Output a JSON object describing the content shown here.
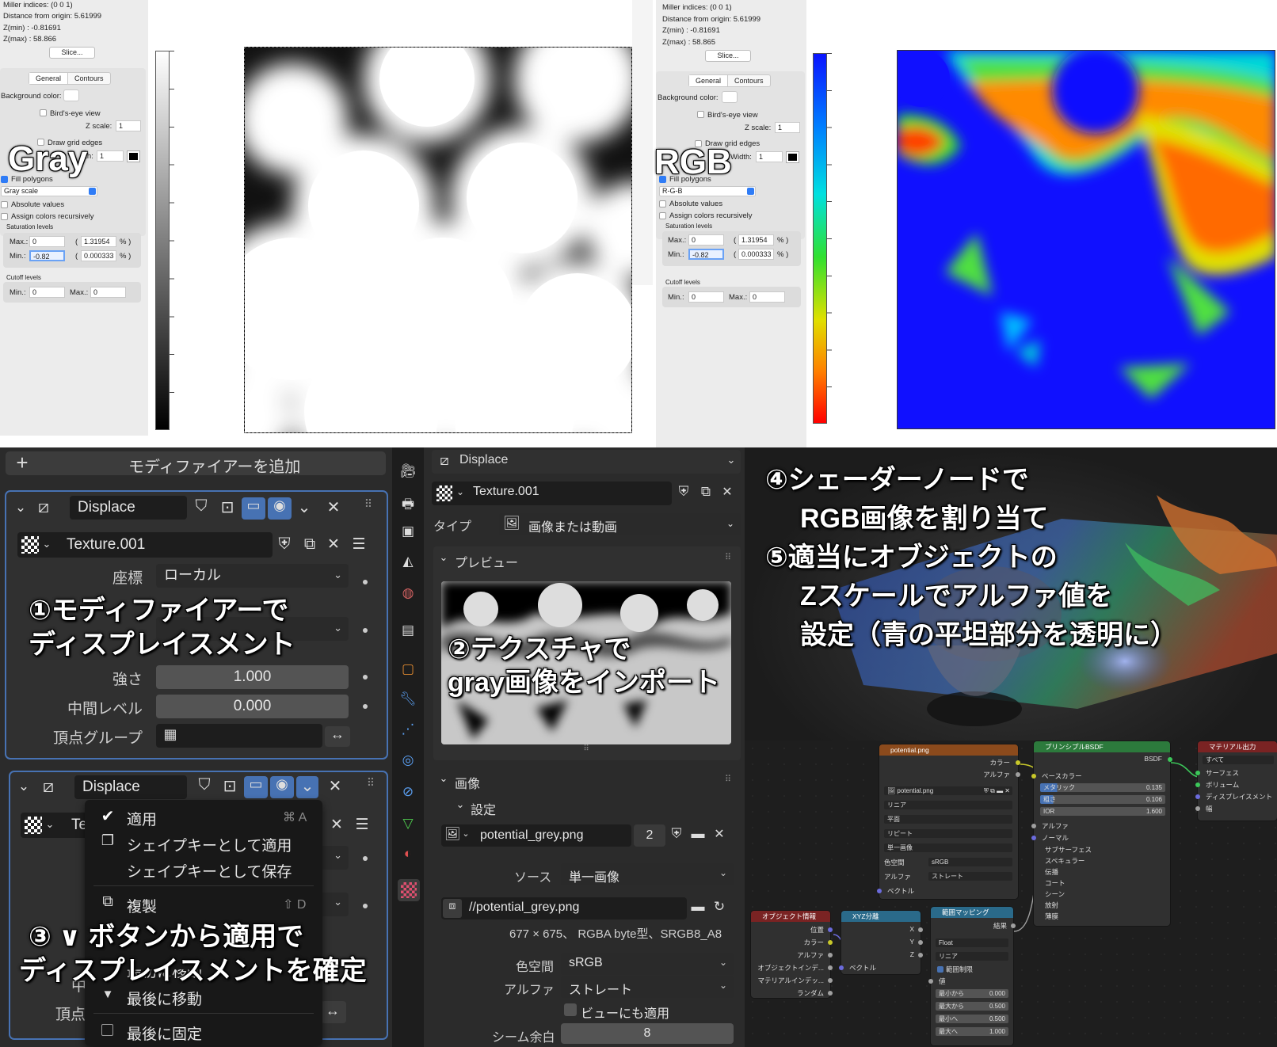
{
  "top_left": {
    "info": [
      "Miller indices: (0 0 1)",
      "Distance from origin: 5.61999",
      "Z(min) : -0.81691",
      "Z(max) : 58.866"
    ],
    "slice_button": "Slice...",
    "tabs": [
      "General",
      "Contours"
    ],
    "background_color": "Background color:",
    "birds_eye": "Bird's-eye view",
    "z_scale_label": "Z scale:",
    "z_scale": "1",
    "draw_grid": "Draw grid edges",
    "width_label": "dth:",
    "width_value": "1",
    "fill_polygons": "Fill polygons",
    "scale_select": "Gray scale",
    "absolute_values": "Absolute values",
    "assign_colors": "Assign colors recursively",
    "saturation": "Saturation levels",
    "max_label": "Max.:",
    "max_value": "0",
    "max_pct": "1.31954",
    "min_label": "Min.:",
    "min_value": "-0.82",
    "min_pct": "0.000333",
    "pct": "% )",
    "paren": "(",
    "cutoff": "Cutoff levels",
    "cut_min_label": "Min.:",
    "cut_min": "0",
    "cut_max_label": "Max.:",
    "cut_max": "0",
    "big_label": "Gray"
  },
  "top_right": {
    "info": [
      "Miller indices: (0 0 1)",
      "Distance from origin: 5.61999",
      "Z(min) : -0.81691",
      "Z(max) : 58.865"
    ],
    "slice_button": "Slice...",
    "tabs": [
      "General",
      "Contours"
    ],
    "background_color": "Background color:",
    "birds_eye": "Bird's-eye view",
    "z_scale_label": "Z scale:",
    "z_scale": "1",
    "draw_grid": "Draw grid edges",
    "width_label": "Width:",
    "width_value": "1",
    "fill_polygons": "Fill polygons",
    "scale_select": "R-G-B",
    "absolute_values": "Absolute values",
    "assign_colors": "Assign colors recursively",
    "saturation": "Saturation levels",
    "max_label": "Max.:",
    "max_value": "0",
    "max_pct": "1.31954",
    "min_label": "Min.:",
    "min_value": "-0.82",
    "min_pct": "0.000333",
    "pct": "% )",
    "paren": "(",
    "cutoff": "Cutoff levels",
    "cut_min_label": "Min.:",
    "cut_min": "0",
    "cut_max_label": "Max.:",
    "cut_max": "0",
    "big_label": "RGB"
  },
  "modifier": {
    "add_modifier": "モディファイアーを追加",
    "name": "Displace",
    "texture": "Texture.001",
    "coord_label": "座標",
    "coord_value": "ローカル",
    "strength_label": "強さ",
    "strength_value": "1.000",
    "midlevel_label": "中間レベル",
    "midlevel_value": "0.000",
    "vgroup_label": "頂点グループ",
    "name2": "Displace",
    "texture2_partial": "Te",
    "vgroup_label2_partial": "頂点",
    "mid_partial": "中",
    "menu": {
      "apply": "適用",
      "apply_shortcut": "⌘ A",
      "apply_shapekey": "シェイプキーとして適用",
      "save_shapekey": "シェイプキーとして保存",
      "duplicate": "複製",
      "duplicate_shortcut": "⇧ D",
      "move_first_partial": "最初に移動",
      "move_last": "最後に移動",
      "pin_last": "最後に固定"
    }
  },
  "texture_panel": {
    "header": "Displace",
    "texture": "Texture.001",
    "type_label": "タイプ",
    "type_value": "画像または動画",
    "preview": "プレビュー",
    "image_section": "画像",
    "settings": "設定",
    "image_name": "potential_grey.png",
    "image_users": "2",
    "source_label": "ソース",
    "source_value": "単一画像",
    "filepath": "//potential_grey.png",
    "image_info": "677 × 675、 RGBA byte型、SRGB8_A8",
    "colorspace_label": "色空間",
    "colorspace_value": "sRGB",
    "alpha_label": "アルファ",
    "alpha_value": "ストレート",
    "view_as_render": "ビューにも適用",
    "seam_label": "シーム余白",
    "seam_value": "8"
  },
  "nodes": {
    "image_node": {
      "title": "potential.png",
      "out_color": "カラー",
      "out_alpha": "アルファ",
      "image": "potential.png",
      "interp": "リニア",
      "proj": "平面",
      "ext": "リピート",
      "src": "単一画像",
      "cs_label": "色空間",
      "cs": "sRGB",
      "alpha_label": "アルファ",
      "alpha": "ストレート",
      "vector": "ベクトル"
    },
    "bsdf": {
      "title": "プリンシプルBSDF",
      "out": "BSDF",
      "base_color": "ベースカラー",
      "metallic": "メタリック",
      "metallic_v": "0.135",
      "roughness": "粗さ",
      "roughness_v": "0.106",
      "ior": "IOR",
      "ior_v": "1.600",
      "alpha": "アルファ",
      "normal": "ノーマル",
      "subs": [
        "サブサーフェス",
        "スペキュラー",
        "伝播",
        "コート",
        "シーン",
        "放射",
        "薄膜"
      ]
    },
    "output": {
      "title": "マテリアル出力",
      "target": "すべて",
      "surface": "サーフェス",
      "volume": "ボリューム",
      "displacement": "ディスプレイスメント",
      "thickness": "幅"
    },
    "object_info": {
      "title": "オブジェクト情報",
      "items": [
        "位置",
        "カラー",
        "アルファ",
        "オブジェクトインデ...",
        "マテリアルインデッ...",
        "ランダム"
      ]
    },
    "separate": {
      "title": "XYZ分離",
      "outs": [
        "X",
        "Y",
        "Z"
      ],
      "in": "ベクトル"
    },
    "map_range": {
      "title": "範囲マッピング",
      "result": "結果",
      "type": "Float",
      "interp": "リニア",
      "clamp": "範囲制限",
      "value": "値",
      "from_min": "最小から",
      "from_min_v": "0.000",
      "from_max": "最大から",
      "from_max_v": "0.500",
      "to_min": "最小へ",
      "to_min_v": "0.500",
      "to_max": "最大へ",
      "to_max_v": "1.000"
    }
  },
  "annotations": {
    "a1_line1": "①モディファイアーで",
    "a1_line2": "ディスプレイスメント",
    "a2_line1": "②テクスチャで",
    "a2_line2": "gray画像をインポート",
    "a3_line1": "③ ∨ ボタンから適用で",
    "a3_line2": "ディスプレイスメントを確定",
    "a4_line1": "④シェーダーノードで",
    "a4_line2": "RGB画像を割り当て",
    "a5_line1": "⑤適当にオブジェクトの",
    "a5_line2": "Zスケールでアルファ値を",
    "a5_line3": "設定（青の平坦部分を透明に）"
  },
  "colors": {
    "blender_bg": "#2b2b2b",
    "blender_field": "#545454",
    "accent_blue": "#4772b3",
    "node_image": "#8b4a1c",
    "node_shader": "#3b8c3b",
    "node_output": "#7a2323",
    "node_input": "#7a2323",
    "node_convert": "#2a6a8a"
  }
}
